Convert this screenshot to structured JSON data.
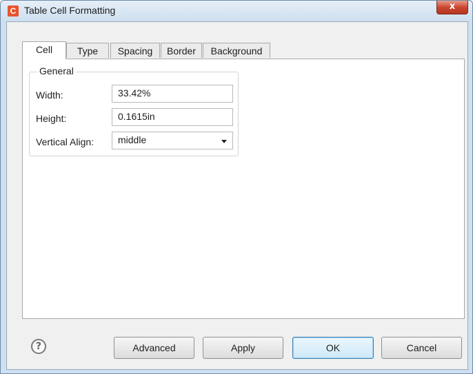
{
  "window": {
    "title": "Table Cell Formatting",
    "app_icon_letter": "C",
    "close_glyph": "x",
    "accent_icon_color": "#e8542d"
  },
  "tabs": [
    {
      "label": "Cell",
      "active": true
    },
    {
      "label": "Type",
      "active": false
    },
    {
      "label": "Spacing",
      "active": false
    },
    {
      "label": "Border",
      "active": false
    },
    {
      "label": "Background",
      "active": false
    }
  ],
  "general": {
    "legend": "General",
    "width_label": "Width:",
    "width_value": "33.42%",
    "height_label": "Height:",
    "height_value": "0.1615in",
    "valign_label": "Vertical Align:",
    "valign_value": "middle"
  },
  "footer": {
    "help_glyph": "?",
    "advanced_label": "Advanced",
    "apply_label": "Apply",
    "ok_label": "OK",
    "cancel_label": "Cancel"
  }
}
